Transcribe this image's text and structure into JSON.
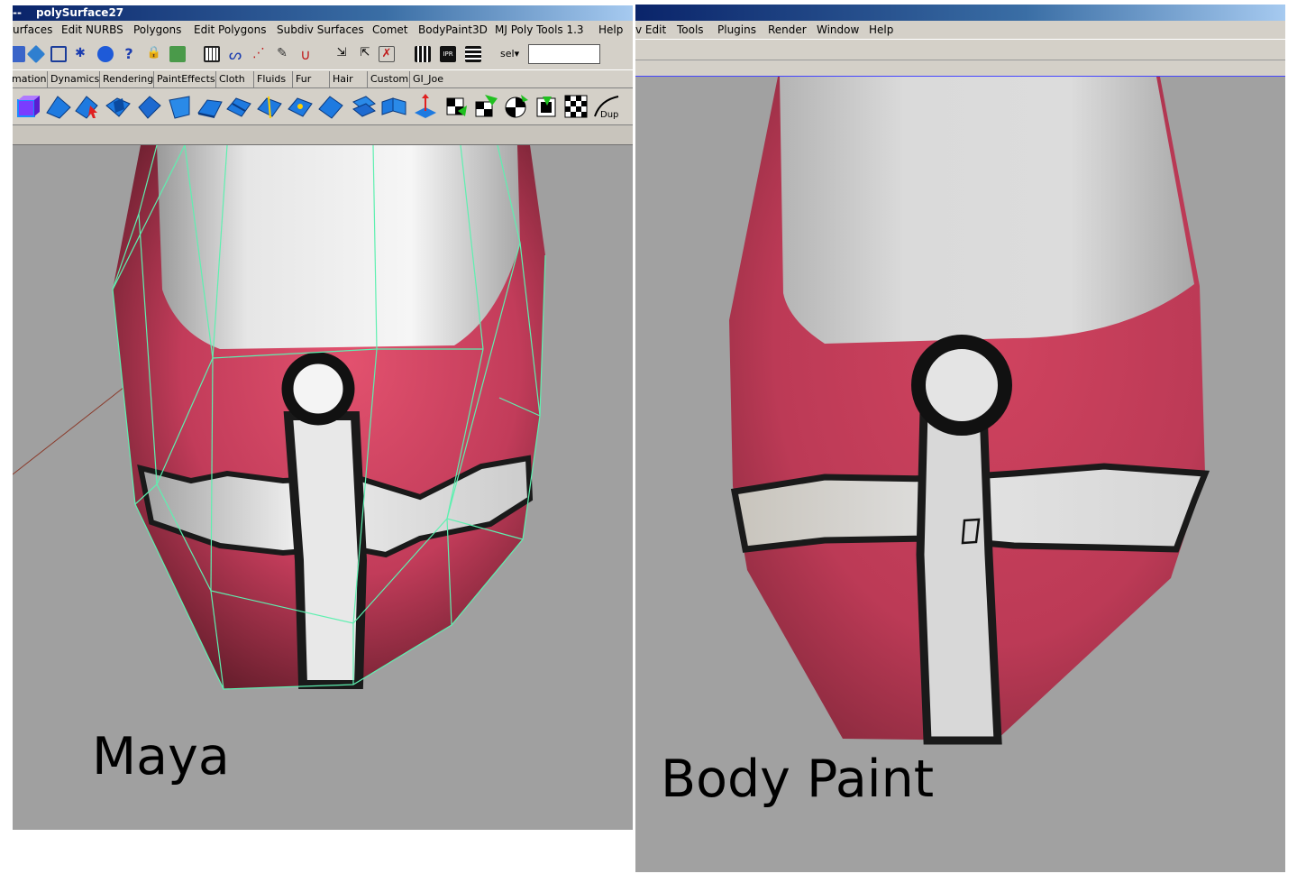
{
  "maya": {
    "title_prefix": "--",
    "window_title": "polySurface27",
    "menu": [
      "urfaces",
      "Edit NURBS",
      "Polygons",
      "Edit Polygons",
      "Subdiv Surfaces",
      "Comet",
      "BodyPaint3D",
      "MJ Poly Tools 1.3",
      "Help"
    ],
    "sel_label": "sel",
    "sel_value": "",
    "shelf_tabs": [
      "mation",
      "Dynamics",
      "Rendering",
      "PaintEffects",
      "Cloth",
      "Fluids",
      "Fur",
      "Hair",
      "Custom",
      "GI_Joe"
    ],
    "shelf_last_label": "Dup",
    "caption": "Maya"
  },
  "bodypaint": {
    "menu": [
      "v Edit",
      "Tools",
      "Plugins",
      "Render",
      "Window",
      "Help"
    ],
    "caption": "Body Paint"
  },
  "colors": {
    "ui_gray": "#d4d0c8",
    "viewport_gray": "#a0a0a0",
    "title_blue": "#0a246a",
    "cloth_red": "#c23c5a",
    "wireframe_green": "#5ef0b0"
  }
}
